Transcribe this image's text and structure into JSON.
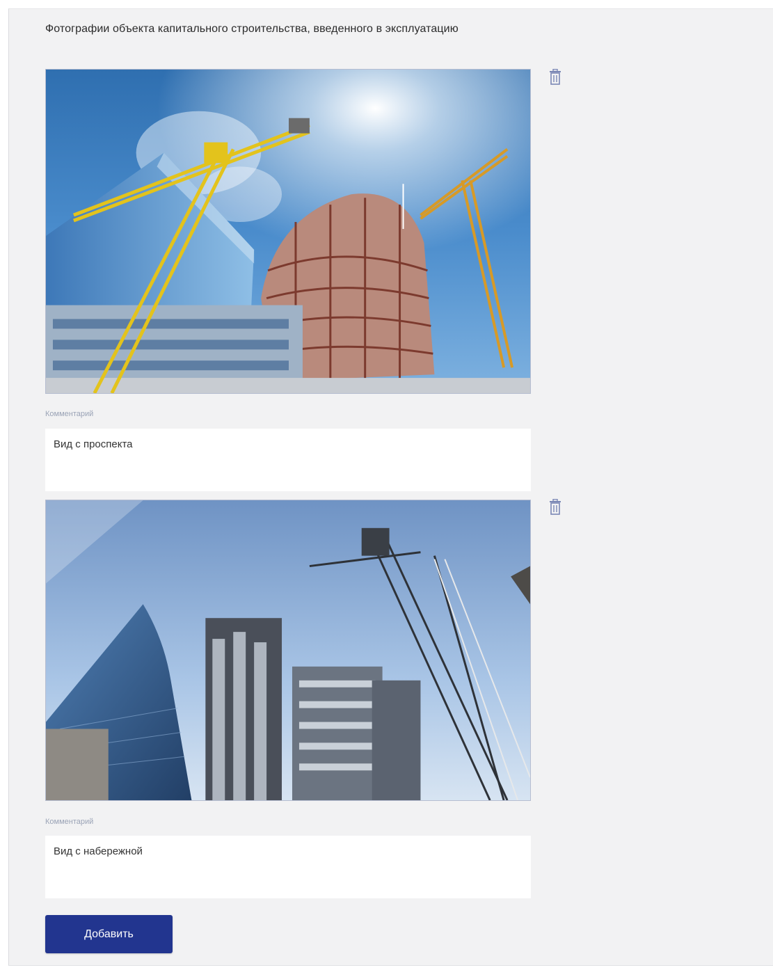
{
  "section": {
    "title": "Фотографии объекта капитального строительства, введенного в эксплуатацию"
  },
  "photos": [
    {
      "alt": "construction-site-cranes",
      "comment_label": "Комментарий",
      "comment_value": "Вид с проспекта",
      "delete_icon": "trash-icon"
    },
    {
      "alt": "skyscrapers-cranes",
      "comment_label": "Комментарий",
      "comment_value": "Вид с набережной",
      "delete_icon": "trash-icon"
    }
  ],
  "actions": {
    "add_label": "Добавить"
  },
  "colors": {
    "primary": "#22358f",
    "panel_bg": "#f2f2f3",
    "icon": "#7a87b5"
  }
}
